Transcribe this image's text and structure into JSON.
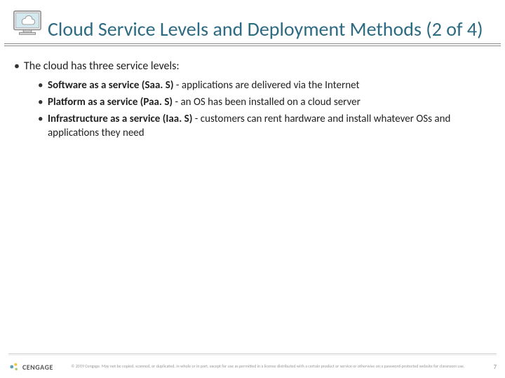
{
  "header": {
    "title": "Cloud Service Levels and Deployment Methods (2 of 4)"
  },
  "content": {
    "lead": "The cloud has three service levels:",
    "items": [
      {
        "bold": "Software as a service (Saa. S)",
        "rest": " - applications are delivered via the Internet"
      },
      {
        "bold": "Platform as a service (Paa. S)",
        "rest": " - an OS has been installed on a cloud server"
      },
      {
        "bold": "Infrastructure as a service (Iaa. S)",
        "rest": " - customers can rent hardware and install whatever OSs and applications they need"
      }
    ]
  },
  "footer": {
    "logo_text": "CENGAGE",
    "copyright": "© 2019 Cengage. May not be copied, scanned, or duplicated, in whole or in part, except for use as permitted in a license distributed with a certain product or service or otherwise on a password-protected website for classroom use.",
    "page": "7"
  }
}
